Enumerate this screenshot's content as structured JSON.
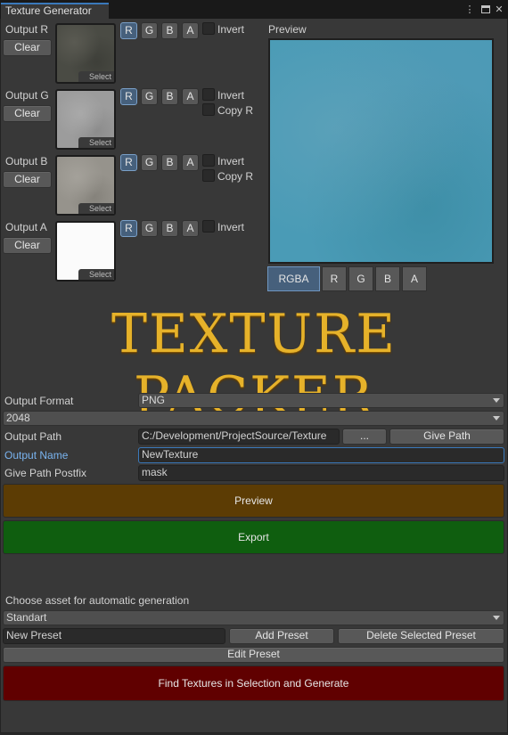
{
  "window": {
    "tab_title": "Texture Generator",
    "menu_icon": "kebab-menu-icon",
    "maximize_icon": "maximize-icon",
    "close_icon": "close-icon"
  },
  "channels": [
    {
      "label": "Output R",
      "clear": "Clear",
      "select": "Select",
      "buttons": [
        "R",
        "G",
        "B",
        "A"
      ],
      "active": "R",
      "invert": "Invert",
      "copy": "",
      "texture": "dark-grunge"
    },
    {
      "label": "Output G",
      "clear": "Clear",
      "select": "Select",
      "buttons": [
        "R",
        "G",
        "B",
        "A"
      ],
      "active": "R",
      "invert": "Invert",
      "copy": "Copy R",
      "texture": "light-grey"
    },
    {
      "label": "Output B",
      "clear": "Clear",
      "select": "Select",
      "buttons": [
        "R",
        "G",
        "B",
        "A"
      ],
      "active": "R",
      "invert": "Invert",
      "copy": "Copy R",
      "texture": "light-stone"
    },
    {
      "label": "Output A",
      "clear": "Clear",
      "select": "Select",
      "buttons": [
        "R",
        "G",
        "B",
        "A"
      ],
      "active": "R",
      "invert": "Invert",
      "copy": "",
      "texture": "white"
    }
  ],
  "preview": {
    "label": "Preview",
    "tabs": [
      "RGBA",
      "R",
      "G",
      "B",
      "A"
    ],
    "active_tab": "RGBA",
    "color": "#4a9bb6"
  },
  "banner": "TEXTURE PACKER",
  "settings": {
    "output_format_label": "Output Format",
    "output_format_value": "PNG",
    "size_value": "2048",
    "output_path_label": "Output Path",
    "output_path_value": "C:/Development/ProjectSource/Texture",
    "browse_label": "...",
    "give_path_label": "Give Path",
    "output_name_label": "Output Name",
    "output_name_value": "NewTexture",
    "postfix_label": "Give Path Postfix",
    "postfix_value": "mask"
  },
  "actions": {
    "preview": "Preview",
    "export": "Export",
    "preview_color": "#5c3c04",
    "export_color": "#0f5e0f"
  },
  "presets": {
    "choose_label": "Choose asset for automatic generation",
    "selected": "Standart",
    "new_preset_value": "New Preset",
    "add": "Add Preset",
    "delete": "Delete Selected Preset",
    "edit": "Edit Preset",
    "find": "Find Textures in Selection and Generate",
    "find_color": "#600000"
  }
}
